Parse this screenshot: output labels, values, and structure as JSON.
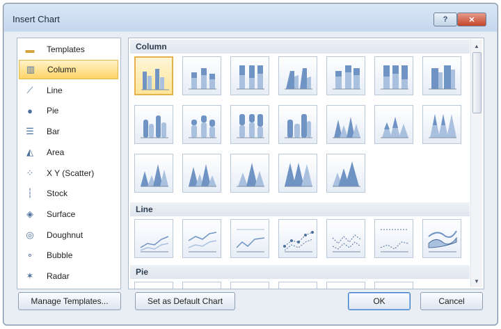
{
  "dialog": {
    "title": "Insert Chart",
    "help_label": "?",
    "close_label": "✕"
  },
  "categories": [
    {
      "label": "Templates",
      "icon": "folder-icon",
      "glyph": "▬"
    },
    {
      "label": "Column",
      "icon": "column-chart-icon",
      "glyph": "▥",
      "selected": true
    },
    {
      "label": "Line",
      "icon": "line-chart-icon",
      "glyph": "⟋"
    },
    {
      "label": "Pie",
      "icon": "pie-chart-icon",
      "glyph": "●"
    },
    {
      "label": "Bar",
      "icon": "bar-chart-icon",
      "glyph": "☰"
    },
    {
      "label": "Area",
      "icon": "area-chart-icon",
      "glyph": "◭"
    },
    {
      "label": "X Y (Scatter)",
      "icon": "scatter-chart-icon",
      "glyph": "⁘"
    },
    {
      "label": "Stock",
      "icon": "stock-chart-icon",
      "glyph": "┆"
    },
    {
      "label": "Surface",
      "icon": "surface-chart-icon",
      "glyph": "◈"
    },
    {
      "label": "Doughnut",
      "icon": "doughnut-chart-icon",
      "glyph": "◎"
    },
    {
      "label": "Bubble",
      "icon": "bubble-chart-icon",
      "glyph": "∘"
    },
    {
      "label": "Radar",
      "icon": "radar-chart-icon",
      "glyph": "✶"
    }
  ],
  "sections": {
    "column": "Column",
    "line": "Line",
    "pie": "Pie"
  },
  "buttons": {
    "manage_templates": "Manage Templates...",
    "set_default": "Set as Default Chart",
    "ok": "OK",
    "cancel": "Cancel"
  },
  "colors": {
    "selection": "#ffd466",
    "accent": "#4c6f9b"
  }
}
